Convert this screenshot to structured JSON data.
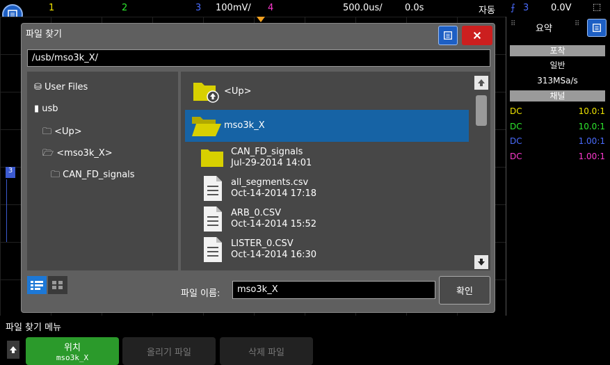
{
  "topbar": {
    "ch1": "1",
    "ch2": "2",
    "ch3": "3",
    "scale3": "100mV/",
    "ch4": "4",
    "timebase": "500.0us/",
    "delay": "0.0s",
    "mode": "자동",
    "trig_ch": "3",
    "trig_level": "0.0V",
    "colors": {
      "ch1": "#f2e600",
      "ch2": "#2ee82e",
      "ch3": "#4a6cff",
      "ch4": "#ff3ad0"
    }
  },
  "dialog": {
    "title": "파일 찾기",
    "path": "/usb/mso3k_X/",
    "tree": [
      {
        "label": "User Files",
        "icon": "drive-icon"
      },
      {
        "label": "usb",
        "icon": "usb-icon"
      },
      {
        "label": "<Up>",
        "icon": "up-folder-icon"
      },
      {
        "label": "<mso3k_X>",
        "icon": "open-folder-icon"
      },
      {
        "label": "CAN_FD_signals",
        "icon": "folder-icon"
      }
    ],
    "files": [
      {
        "name": "<Up>",
        "date": "",
        "type": "up"
      },
      {
        "name": "mso3k_X",
        "date": "",
        "type": "folder-open"
      },
      {
        "name": "CAN_FD_signals",
        "date": "Jul-29-2014 14:01",
        "type": "folder"
      },
      {
        "name": "all_segments.csv",
        "date": "Oct-14-2014 17:18",
        "type": "file"
      },
      {
        "name": "ARB_0.CSV",
        "date": "Oct-14-2014 15:52",
        "type": "file"
      },
      {
        "name": "LISTER_0.CSV",
        "date": "Oct-14-2014 16:30",
        "type": "file"
      }
    ],
    "filename_label": "파일 이름:",
    "filename_value": "mso3k_X",
    "ok_label": "확인"
  },
  "side_panel": {
    "summary_label": "요약",
    "acquire_label": "포착",
    "acquire_mode": "일반",
    "sample_rate": "313MSa/s",
    "channels_label": "채널",
    "channels": [
      {
        "coupling": "DC",
        "ratio": "10.0:1",
        "color": "#f2e600"
      },
      {
        "coupling": "DC",
        "ratio": "10.0:1",
        "color": "#2ee82e"
      },
      {
        "coupling": "DC",
        "ratio": "1.00:1",
        "color": "#4a6cff"
      },
      {
        "coupling": "DC",
        "ratio": "1.00:1",
        "color": "#ff3ad0"
      }
    ]
  },
  "softkeys": {
    "menu_title": "파일 찾기 메뉴",
    "location_label": "위치",
    "location_value": "mso3k_X",
    "upload_label": "올리기 파일",
    "delete_label": "삭제 파일"
  }
}
